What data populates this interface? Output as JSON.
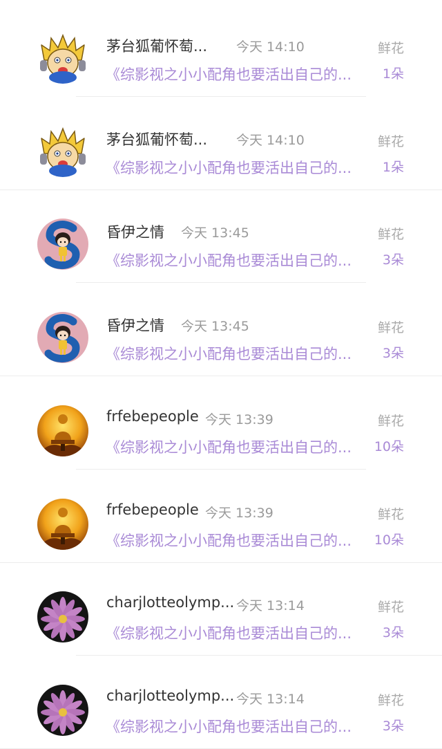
{
  "list_label": "鲜花",
  "book_title": "《综影视之小小配角也要活出自己的...",
  "items": [
    {
      "name": "茅台狐葡怀萄...",
      "time": "今天 14:10",
      "count": "1朵",
      "avatar": "cartoon-character-avatar"
    },
    {
      "name": "茅台狐葡怀萄...",
      "time": "今天 14:10",
      "count": "1朵",
      "avatar": "cartoon-character-avatar"
    },
    {
      "name": "昏伊之情",
      "time": "今天 13:45",
      "count": "3朵",
      "avatar": "letter-s-girl-avatar"
    },
    {
      "name": "昏伊之情",
      "time": "今天 13:45",
      "count": "3朵",
      "avatar": "letter-s-girl-avatar"
    },
    {
      "name": "frfebepeople",
      "time": "今天 13:39",
      "count": "10朵",
      "avatar": "golden-buddha-avatar"
    },
    {
      "name": "frfebepeople",
      "time": "今天 13:39",
      "count": "10朵",
      "avatar": "golden-buddha-avatar"
    },
    {
      "name": "charjlotteolymp...",
      "time": "今天 13:14",
      "count": "3朵",
      "avatar": "purple-flower-avatar"
    },
    {
      "name": "charjlotteolymp...",
      "time": "今天 13:14",
      "count": "3朵",
      "avatar": "purple-flower-avatar"
    }
  ]
}
